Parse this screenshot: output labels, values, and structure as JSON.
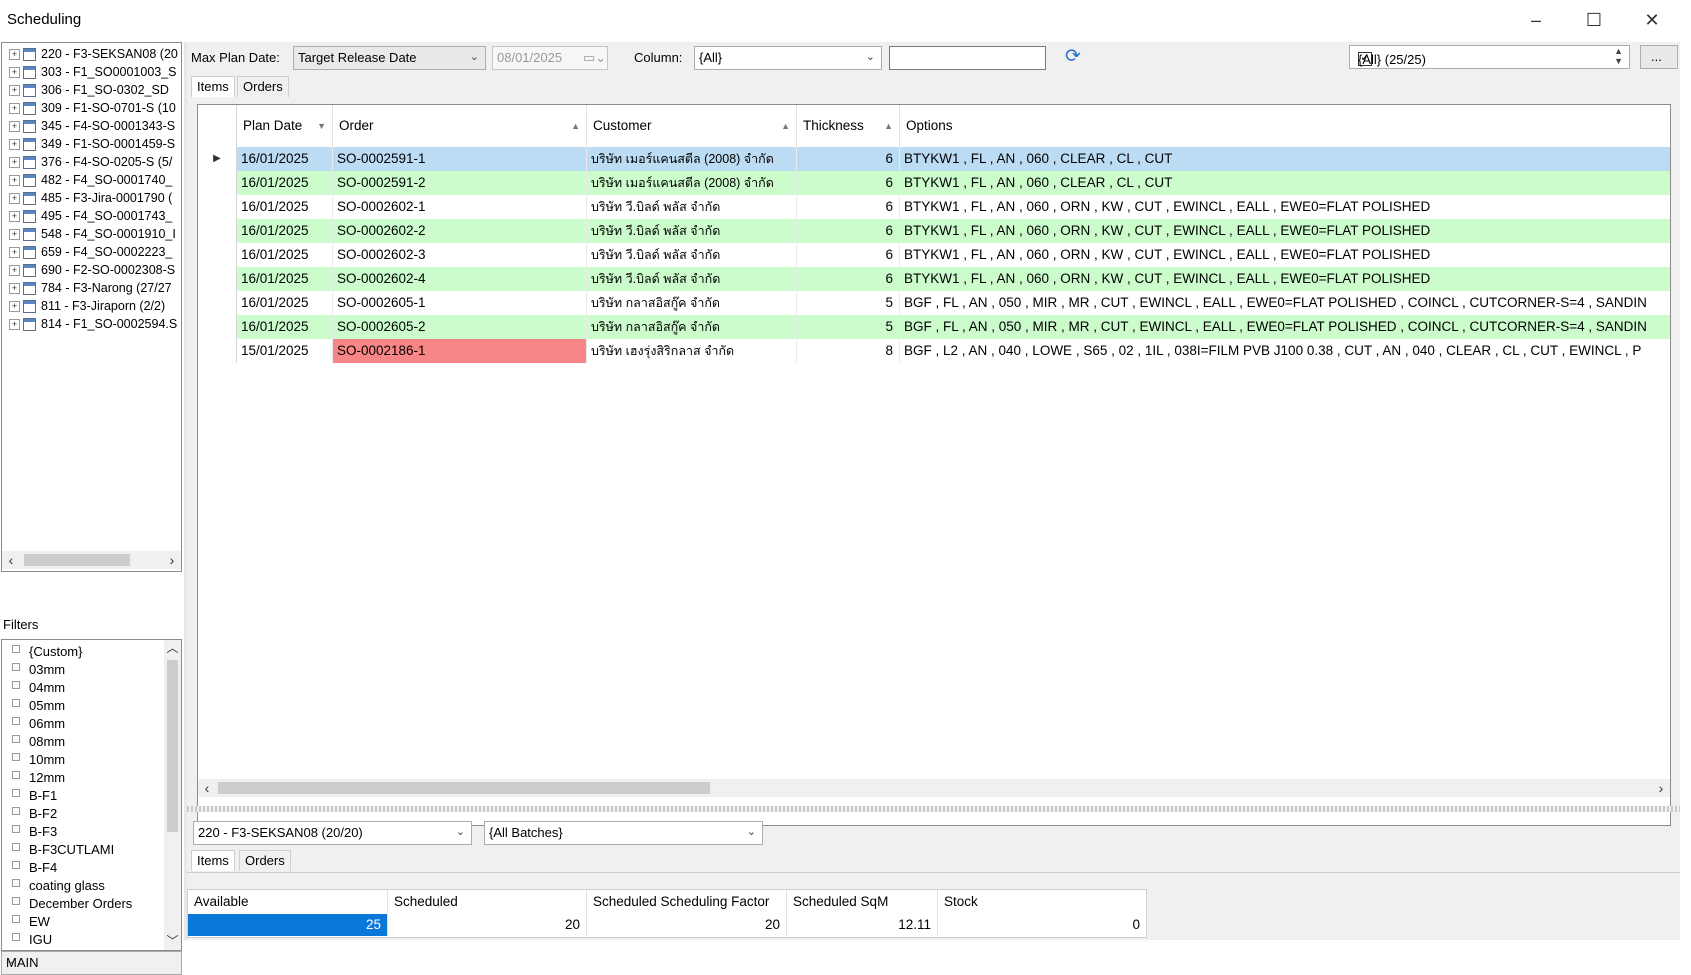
{
  "window": {
    "title": "Scheduling"
  },
  "tree": {
    "items": [
      "220 - F3-SEKSAN08 (20",
      "303 - F1_SO0001003_S",
      "306 - F1_SO-0302_SD",
      "309 - F1-SO-0701-S (10",
      "345 - F4-SO-0001343-S",
      "349 - F1-SO-0001459-S",
      "376 - F4-SO-0205-S (5/",
      "482 - F4_SO-0001740_",
      "485 - F3-Jira-0001790 (",
      "495 - F4_SO-0001743_",
      "548 - F4_SO-0001910_I",
      "659 - F4_SO-0002223_",
      "690 - F2-SO-0002308-S",
      "784 - F3-Narong (27/27",
      "811 - F3-Jiraporn (2/2)",
      "814 - F1_SO-0002594.S"
    ]
  },
  "filters": {
    "label": "Filters",
    "items": [
      "{Custom}",
      "03mm",
      "04mm",
      "05mm",
      "06mm",
      "08mm",
      "10mm",
      "12mm",
      "B-F1",
      "B-F2",
      "B-F3",
      "B-F3CUTLAMI",
      "B-F4",
      "coating glass",
      "December Orders",
      "EW",
      "IGU"
    ],
    "bottom_select": "MAIN"
  },
  "toolbar": {
    "max_plan_label": "Max Plan Date:",
    "date_mode": "Target Release Date",
    "date_value": "08/01/2025",
    "column_label": "Column:",
    "column_value": "{All}",
    "search_value": "",
    "all_filter": "{All} (25/25)",
    "more": "..."
  },
  "top_tabs": [
    "Items",
    "Orders"
  ],
  "grid": {
    "columns": [
      "Plan Date",
      "Order",
      "Customer",
      "Thickness",
      "Options"
    ],
    "rows": [
      {
        "date": "16/01/2025",
        "order": "SO-0002591-1",
        "customer": "บริษัท เมอร์แคนสตีล (2008)  จำกัด",
        "thickness": "6",
        "options": "BTYKW1 , FL , AN , 060 , CLEAR , CL , CUT",
        "style": "selected"
      },
      {
        "date": "16/01/2025",
        "order": "SO-0002591-2",
        "customer": "บริษัท เมอร์แคนสตีล (2008)  จำกัด",
        "thickness": "6",
        "options": "BTYKW1 , FL , AN , 060 , CLEAR , CL , CUT",
        "style": "green"
      },
      {
        "date": "16/01/2025",
        "order": "SO-0002602-1",
        "customer": "บริษัท วี.บิลด์ พลัส  จำกัด",
        "thickness": "6",
        "options": "BTYKW1 , FL , AN , 060 , ORN , KW , CUT , EWINCL , EALL , EWE0=FLAT POLISHED",
        "style": "white"
      },
      {
        "date": "16/01/2025",
        "order": "SO-0002602-2",
        "customer": "บริษัท วี.บิลด์ พลัส  จำกัด",
        "thickness": "6",
        "options": "BTYKW1 , FL , AN , 060 , ORN , KW , CUT , EWINCL , EALL , EWE0=FLAT POLISHED",
        "style": "green"
      },
      {
        "date": "16/01/2025",
        "order": "SO-0002602-3",
        "customer": "บริษัท วี.บิลด์ พลัส  จำกัด",
        "thickness": "6",
        "options": "BTYKW1 , FL , AN , 060 , ORN , KW , CUT , EWINCL , EALL , EWE0=FLAT POLISHED",
        "style": "white"
      },
      {
        "date": "16/01/2025",
        "order": "SO-0002602-4",
        "customer": "บริษัท วี.บิลด์ พลัส  จำกัด",
        "thickness": "6",
        "options": "BTYKW1 , FL , AN , 060 , ORN , KW , CUT , EWINCL , EALL , EWE0=FLAT POLISHED",
        "style": "green"
      },
      {
        "date": "16/01/2025",
        "order": "SO-0002605-1",
        "customer": "บริษัท กลาสอิสกู๊ค  จำกัด",
        "thickness": "5",
        "options": "BGF , FL , AN , 050 , MIR , MR , CUT , EWINCL , EALL , EWE0=FLAT POLISHED , COINCL , CUTCORNER-S=4 , SANDIN",
        "style": "white"
      },
      {
        "date": "16/01/2025",
        "order": "SO-0002605-2",
        "customer": "บริษัท กลาสอิสกู๊ค  จำกัด",
        "thickness": "5",
        "options": "BGF , FL , AN , 050 , MIR , MR , CUT , EWINCL , EALL , EWE0=FLAT POLISHED , COINCL , CUTCORNER-S=4 , SANDIN",
        "style": "green"
      },
      {
        "date": "15/01/2025",
        "order": "SO-0002186-1",
        "customer": "บริษัท เฮงรุ่งสิริกลาส  จำกัด",
        "thickness": "8",
        "options": "BGF , L2 , AN , 040 , LOWE , S65 , 02 , 1IL , 038I=FILM PVB J100 0.38 , CUT , AN , 040 , CLEAR , CL , CUT , EWINCL , P",
        "style": "red-order"
      }
    ]
  },
  "bottom": {
    "batch_select": "220 - F3-SEKSAN08 (20/20)",
    "all_batches": "{All Batches}",
    "tabs": [
      "Items",
      "Orders"
    ],
    "summary_headers": [
      "Available",
      "Scheduled",
      "Scheduled Scheduling Factor",
      "Scheduled SqM",
      "Stock"
    ],
    "summary_values": [
      "25",
      "20",
      "20",
      "12.11",
      "0"
    ]
  }
}
